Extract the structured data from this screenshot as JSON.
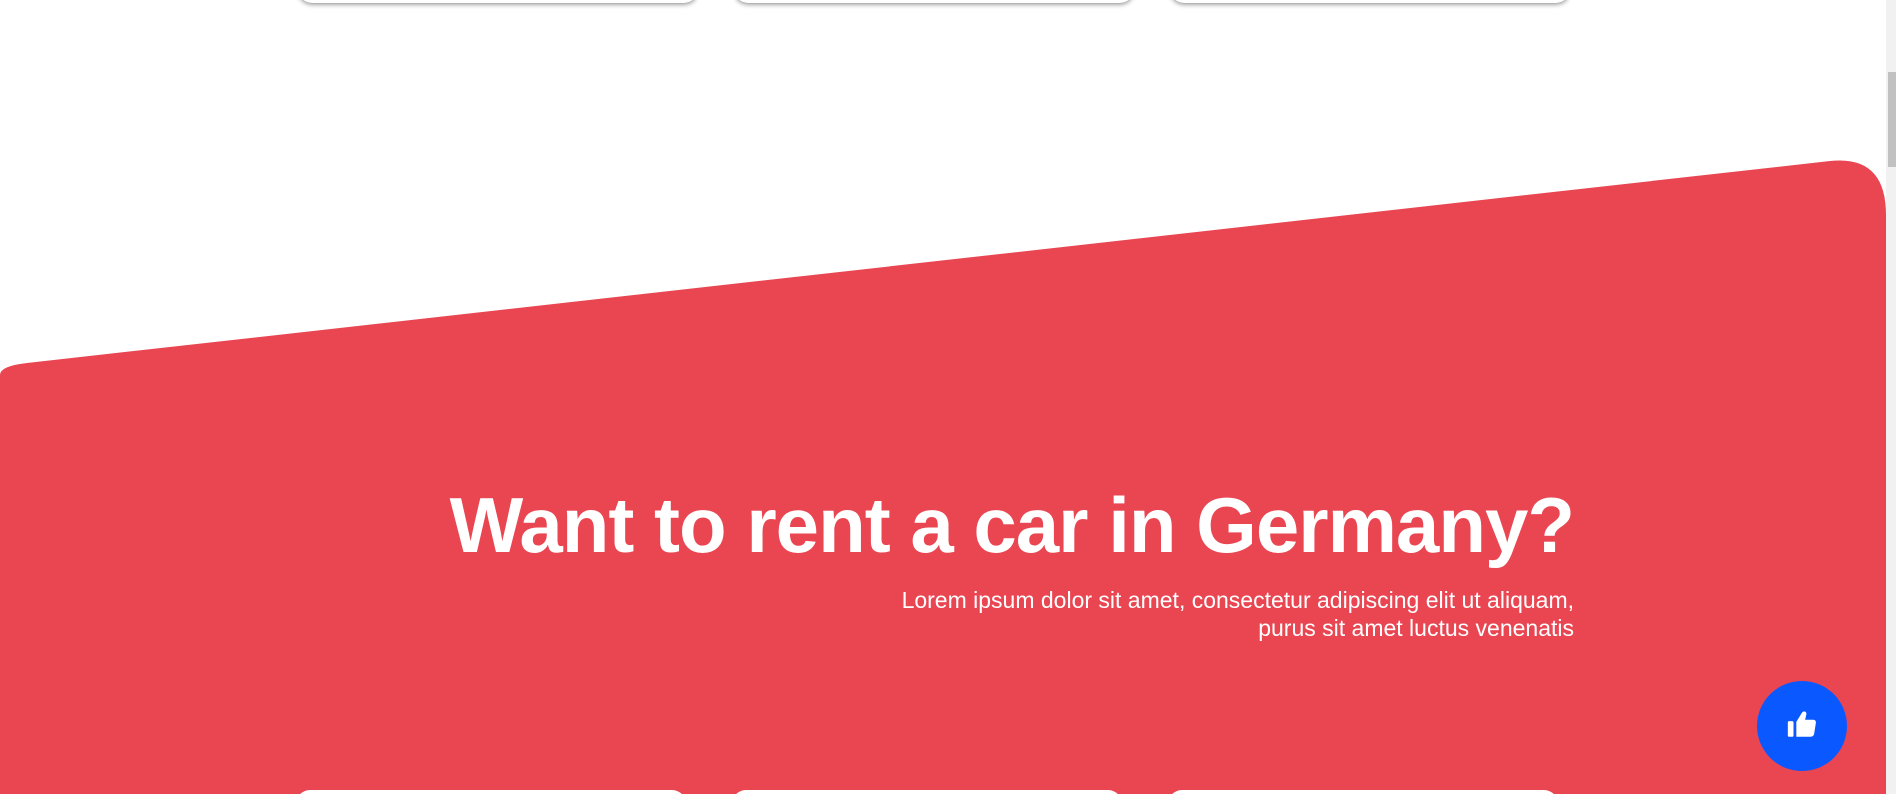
{
  "promo": {
    "title": "Want to rent a car in Germany?",
    "subtitle": "Lorem ipsum dolor sit amet, consectetur adipiscing elit ut aliquam, purus sit amet luctus venenatis"
  },
  "like_button": {
    "icon": "thumbs-up-icon"
  },
  "colors": {
    "band": "#e94652",
    "fab": "#0a58ff",
    "text": "#ffffff"
  }
}
